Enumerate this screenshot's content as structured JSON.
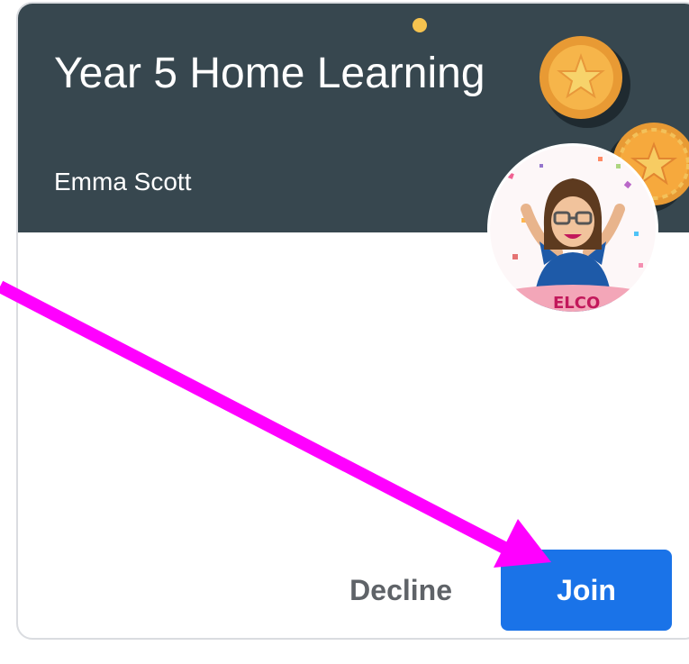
{
  "card": {
    "class_title": "Year 5 Home Learning",
    "teacher_name": "Emma Scott",
    "avatar_icon": "bitmoji-avatar-icon",
    "decorations": [
      "coin-star-icon",
      "coin-star-icon"
    ]
  },
  "actions": {
    "decline_label": "Decline",
    "join_label": "Join"
  },
  "colors": {
    "banner": "#37474f",
    "join_button": "#1a73e8",
    "annotation_arrow": "#ff00ff"
  }
}
